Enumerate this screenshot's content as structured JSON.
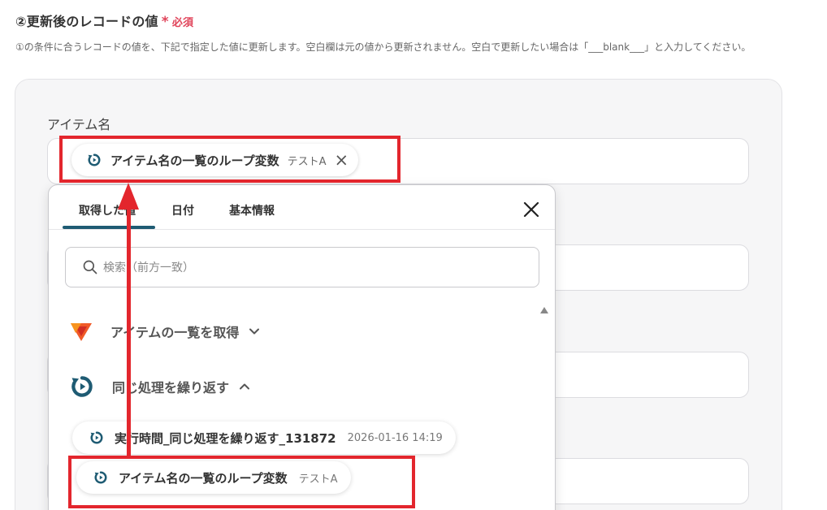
{
  "header": {
    "title": "②更新後のレコードの値",
    "required_mark": "*",
    "required_label": "必須",
    "description": "①の条件に合うレコードの値を、下記で指定した値に更新します。空白欄は元の値から更新されません。空白で更新したい場合は「___blank___」と入力してください。"
  },
  "field": {
    "label": "アイテム名",
    "chip_label": "アイテム名の一覧のループ変数",
    "chip_value": "テストA"
  },
  "dropdown": {
    "tabs": [
      "取得した値",
      "日付",
      "基本情報"
    ],
    "active_tab": 0,
    "search_placeholder": "検索（前方一致）",
    "groups": [
      {
        "label": "アイテムの一覧を取得",
        "expanded": false
      },
      {
        "label": "同じ処理を繰り返す",
        "expanded": true
      }
    ],
    "items": [
      {
        "label": "実行時間_同じ処理を繰り返す_131872",
        "value": "2026-01-16 14:19"
      },
      {
        "label": "アイテム名の一覧のループ変数",
        "value": "テストA"
      }
    ]
  },
  "colors": {
    "accent": "#1e5b73",
    "annotation": "#e3262d",
    "required": "#e0445a"
  }
}
